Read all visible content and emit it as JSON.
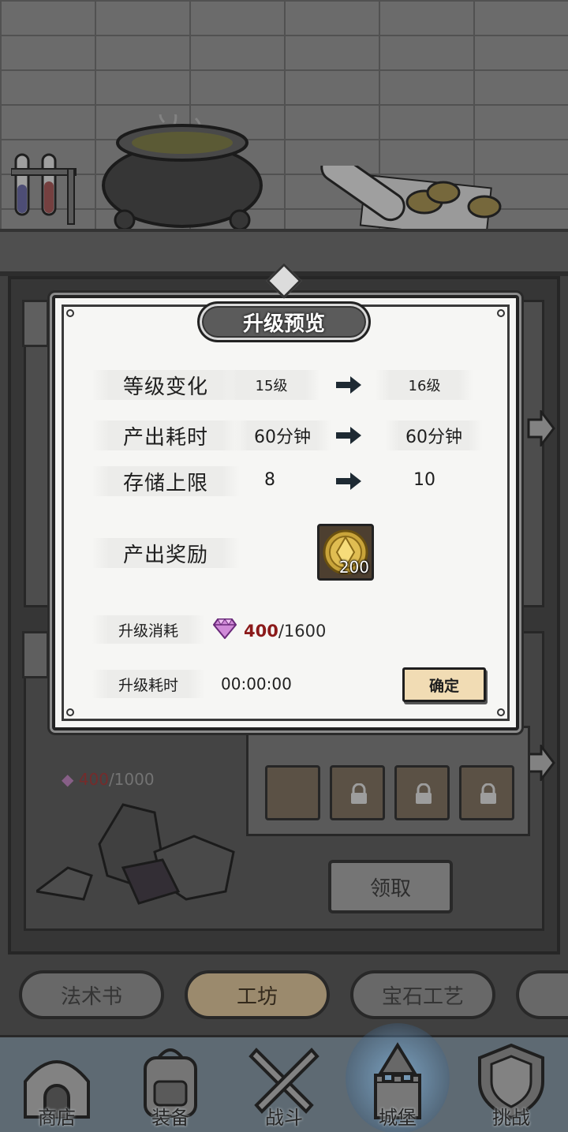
{
  "dialog": {
    "title": "升级预览",
    "rows": [
      {
        "label": "等级变化",
        "from": "15级",
        "to": "16级"
      },
      {
        "label": "产出耗时",
        "from": "60分钟",
        "to": "60分钟"
      },
      {
        "label": "存储上限",
        "from": "8",
        "to": "10"
      }
    ],
    "reward": {
      "label": "产出奖励",
      "icon": "gold-coin-icon",
      "amount": "200"
    },
    "cost": {
      "label": "升级消耗",
      "icon": "purple-gem-icon",
      "current": "400",
      "required": "/1600"
    },
    "duration": {
      "label": "升级耗时",
      "value": "00:00:00"
    },
    "confirm_label": "确定"
  },
  "background": {
    "cost_current": "400",
    "cost_required": "/1000",
    "claim_label": "领取"
  },
  "category_tabs": [
    {
      "label": "法术书",
      "active": false
    },
    {
      "label": "工坊",
      "active": true
    },
    {
      "label": "宝石工艺",
      "active": false
    }
  ],
  "bottom_nav": [
    {
      "label": "商店",
      "icon": "shop-hut-icon",
      "active": false
    },
    {
      "label": "装备",
      "icon": "backpack-icon",
      "active": false
    },
    {
      "label": "战斗",
      "icon": "crossed-swords-icon",
      "active": false
    },
    {
      "label": "城堡",
      "icon": "castle-wizard-icon",
      "active": true
    },
    {
      "label": "挑战",
      "icon": "shield-icon",
      "active": false
    }
  ],
  "colors": {
    "cost_current": "#8b1a1a",
    "confirm_bg": "#f1dcb4",
    "active_tab": "#b9a480",
    "nav_bg": "#6e7d88"
  }
}
